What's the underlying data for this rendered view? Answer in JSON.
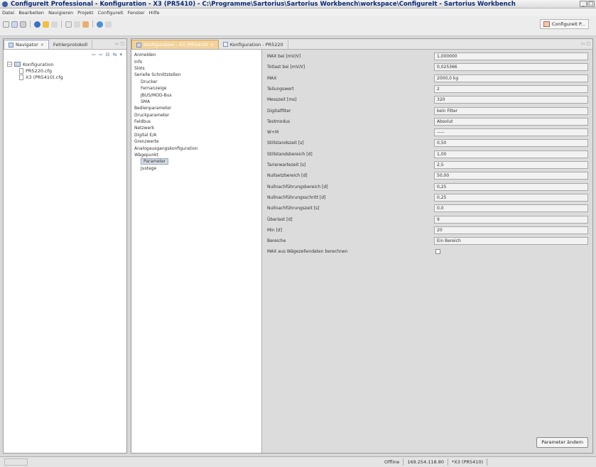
{
  "window": {
    "title": "ConfigureIt Professional - Konfiguration - X3 (PR5410) - C:\\Programme\\Sartorius\\Sartorius Workbench\\workspace\\ConfigureIt - Sartorius Workbench"
  },
  "menu": [
    "Datei",
    "Bearbeiten",
    "Navigieren",
    "Projekt",
    "ConfigureIt",
    "Fenster",
    "Hilfe"
  ],
  "perspective": {
    "label": "ConfigureIt P..."
  },
  "left_pane": {
    "tabs": [
      "Navigator",
      "Fehlerprotokoll"
    ],
    "tree": {
      "root": "Konfiguration",
      "children": [
        "PR5220.cfg",
        "X3 (PR5410).cfg"
      ]
    }
  },
  "editor": {
    "tabs": [
      "Konfiguration - X3 (PR5410)",
      "Konfiguration - PR5220"
    ],
    "outline": [
      {
        "label": "Anmelden",
        "level": 0
      },
      {
        "label": "Info",
        "level": 0
      },
      {
        "label": "Slots",
        "level": 0
      },
      {
        "label": "Serielle Schnittstellen",
        "level": 0
      },
      {
        "label": "Drucker",
        "level": 1
      },
      {
        "label": "Fernanzeige",
        "level": 1
      },
      {
        "label": "JBUS/MOD-Bus",
        "level": 1
      },
      {
        "label": "SMA",
        "level": 1
      },
      {
        "label": "Bedienparameter",
        "level": 0
      },
      {
        "label": "Druckparameter",
        "level": 0
      },
      {
        "label": "Feldbus",
        "level": 0
      },
      {
        "label": "Netzwerk",
        "level": 0
      },
      {
        "label": "Digital E/A",
        "level": 0
      },
      {
        "label": "Grenzwerte",
        "level": 0
      },
      {
        "label": "Analogausgangskonfiguration",
        "level": 0
      },
      {
        "label": "Wägepunkt",
        "level": 0
      },
      {
        "label": "Parameter",
        "level": 1,
        "selected": true
      },
      {
        "label": "Justage",
        "level": 1
      }
    ],
    "parameters": [
      {
        "label": "MAX bei [mV/V]",
        "value": "1,000000"
      },
      {
        "label": "Totlast bei [mV/V]",
        "value": "0,025366"
      },
      {
        "label": "MAX",
        "value": "2000,0 kg"
      },
      {
        "label": "Teilungswert",
        "value": "2"
      },
      {
        "label": "Messzeit [ms]",
        "value": "320"
      },
      {
        "label": "Digitalfilter",
        "value": "kein Filter"
      },
      {
        "label": "Testmodus",
        "value": "Absolut"
      },
      {
        "label": "W+M",
        "value": "-----"
      },
      {
        "label": "Stillstandszeit [s]",
        "value": "0,50"
      },
      {
        "label": "Stillstandsbereich [d]",
        "value": "1,00"
      },
      {
        "label": "Tarierwartezeit [s]",
        "value": "2,5"
      },
      {
        "label": "Nullsetzbereich [d]",
        "value": "50,00"
      },
      {
        "label": "Nullnachführungsbereich [d]",
        "value": "0,25"
      },
      {
        "label": "Nullnachführungsschritt [d]",
        "value": "0,25"
      },
      {
        "label": "Nullnachführungszeit [s]",
        "value": "0,0"
      },
      {
        "label": "Überlast [d]",
        "value": "9"
      },
      {
        "label": "Min [d]",
        "value": "20"
      },
      {
        "label": "Bereiche",
        "value": "Ein Bereich"
      },
      {
        "label": "MAX aus Wägezellendaten berechnen",
        "value": "",
        "checkbox": true
      }
    ],
    "apply_button": "Parameter ändern"
  },
  "status": {
    "mode": "Offline",
    "ip": "169.254.118.80",
    "device": "*X3 (PR5410)"
  }
}
